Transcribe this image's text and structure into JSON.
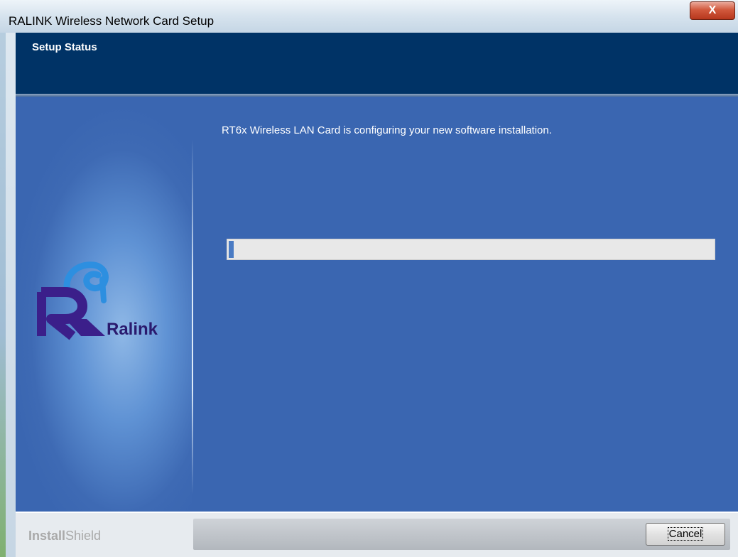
{
  "window": {
    "title": "RALINK Wireless Network Card Setup",
    "close_label": "X"
  },
  "header": {
    "title": "Setup Status"
  },
  "main": {
    "status_message": "RT6x Wireless LAN Card is configuring your new software installation.",
    "progress": 0.01
  },
  "branding": {
    "logo_text": "Ralink",
    "installshield_bold": "Install",
    "installshield_thin": "Shield"
  },
  "footer": {
    "cancel_label": "Cancel"
  },
  "colors": {
    "header_bg": "#003366",
    "content_bg": "#3a66b1",
    "progress_fill": "#4a7bc4",
    "logo_purple": "#3b1f8a"
  }
}
